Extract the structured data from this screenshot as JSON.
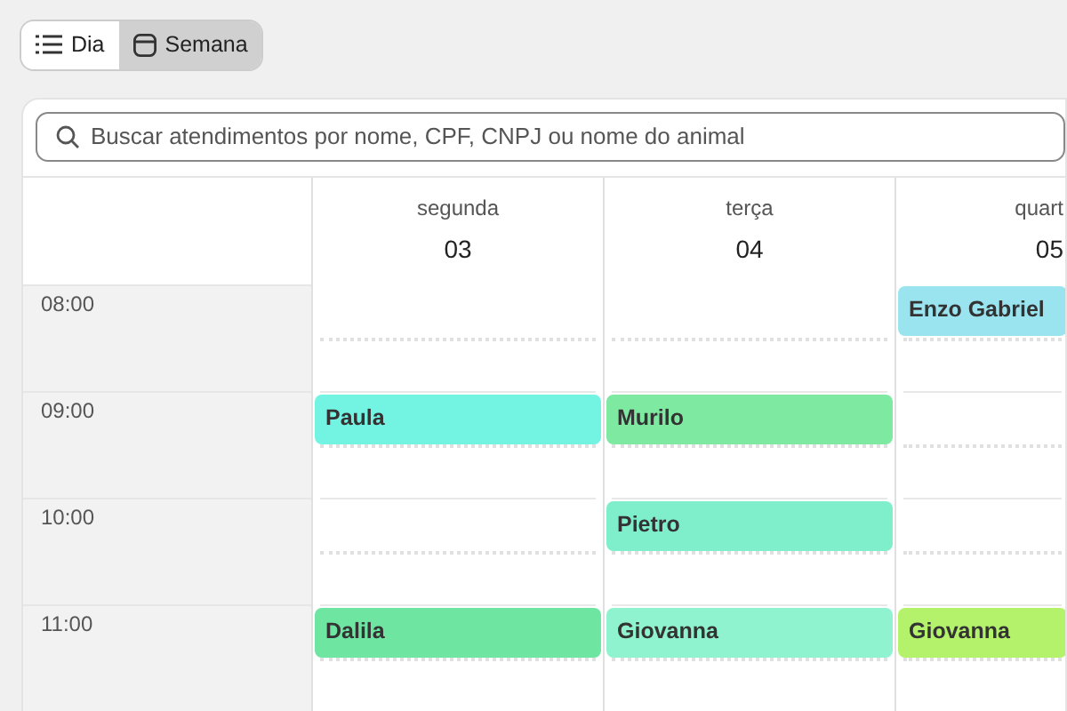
{
  "view_toggle": [
    {
      "label": "Dia",
      "kind": "list",
      "selected": false
    },
    {
      "label": "Semana",
      "kind": "calendar",
      "selected": true
    }
  ],
  "search": {
    "placeholder": "Buscar atendimentos por nome, CPF, CNPJ ou nome do animal"
  },
  "days": [
    {
      "weekday": "segunda",
      "date": "03"
    },
    {
      "weekday": "terça",
      "date": "04"
    },
    {
      "weekday": "quart",
      "date": "05"
    }
  ],
  "rows": [
    {
      "time": "08:00",
      "cells": [
        null,
        null,
        {
          "name": "Enzo Gabriel",
          "color": "#99e4ef"
        }
      ]
    },
    {
      "time": "09:00",
      "cells": [
        {
          "name": "Paula",
          "color": "#73f4e2"
        },
        {
          "name": "Murilo",
          "color": "#7ee9a0"
        },
        null
      ]
    },
    {
      "time": "10:00",
      "cells": [
        null,
        {
          "name": "Pietro",
          "color": "#7eeecb"
        },
        null
      ]
    },
    {
      "time": "11:00",
      "cells": [
        {
          "name": "Dalila",
          "color": "#6ee6a2"
        },
        {
          "name": "Giovanna",
          "color": "#8ff3d0"
        },
        {
          "name": "Giovanna",
          "color": "#b4f26c"
        }
      ]
    }
  ]
}
